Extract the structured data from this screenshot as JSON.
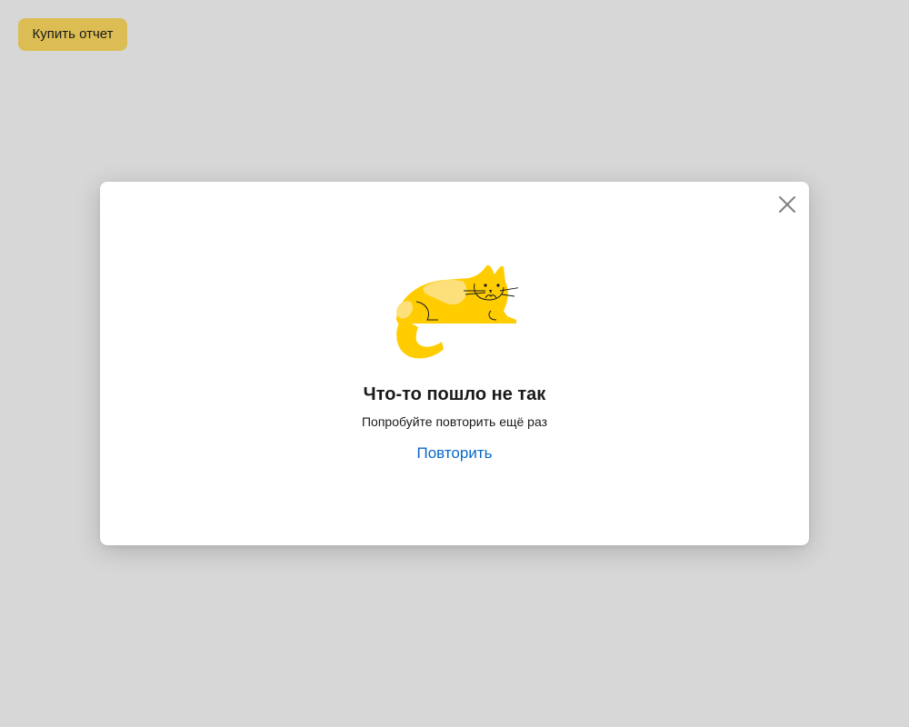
{
  "toolbar": {
    "buy_report_label": "Купить отчет",
    "accent_color": "#dbbd53"
  },
  "error_dialog": {
    "title": "Что-то пошло не так",
    "message": "Попробуйте повторить ещё раз",
    "retry_label": "Повторить",
    "link_color": "#0a68c8",
    "illustration": "sad-cat-illustration",
    "close_icon": "close-icon"
  }
}
